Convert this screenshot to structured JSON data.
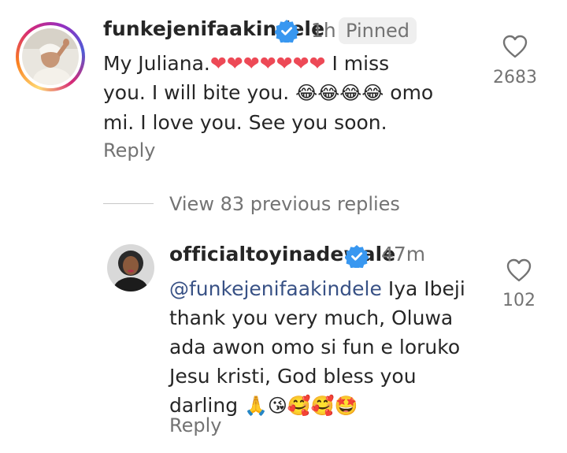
{
  "pinned_comment": {
    "username": "funkejenifaakindele",
    "time": "1h",
    "pinned_label": "Pinned",
    "text_line1_before": "My Juliana.",
    "hearts": "❤❤❤❤❤❤❤",
    "text_line1_after": " I miss",
    "text_line2_before": "you. I will bite you. ",
    "laugh_emojis": "😂😂😂😂",
    "text_line2_after": " omo",
    "text_line3": "mi. I love you. See you soon.",
    "reply_label": "Reply",
    "like_count": "2683"
  },
  "view_replies": "View 83 previous replies",
  "reply_comment": {
    "username": "officialtoyinadewale",
    "time": "47m",
    "mention": "@funkejenifaakindele",
    "text_line1_rest": " Iya Ibeji",
    "text_line2": "thank you very much, Oluwa",
    "text_line3": "ada awon omo si fun e loruko",
    "text_line4": "Jesu kristi, God bless you",
    "text_line5": "darling ",
    "emojis": "🙏😘🥰🥰🤩",
    "reply_label": "Reply",
    "like_count": "102"
  },
  "colors": {
    "verified": "#3897f0",
    "heart": "#ed4956",
    "muted": "#737373"
  }
}
